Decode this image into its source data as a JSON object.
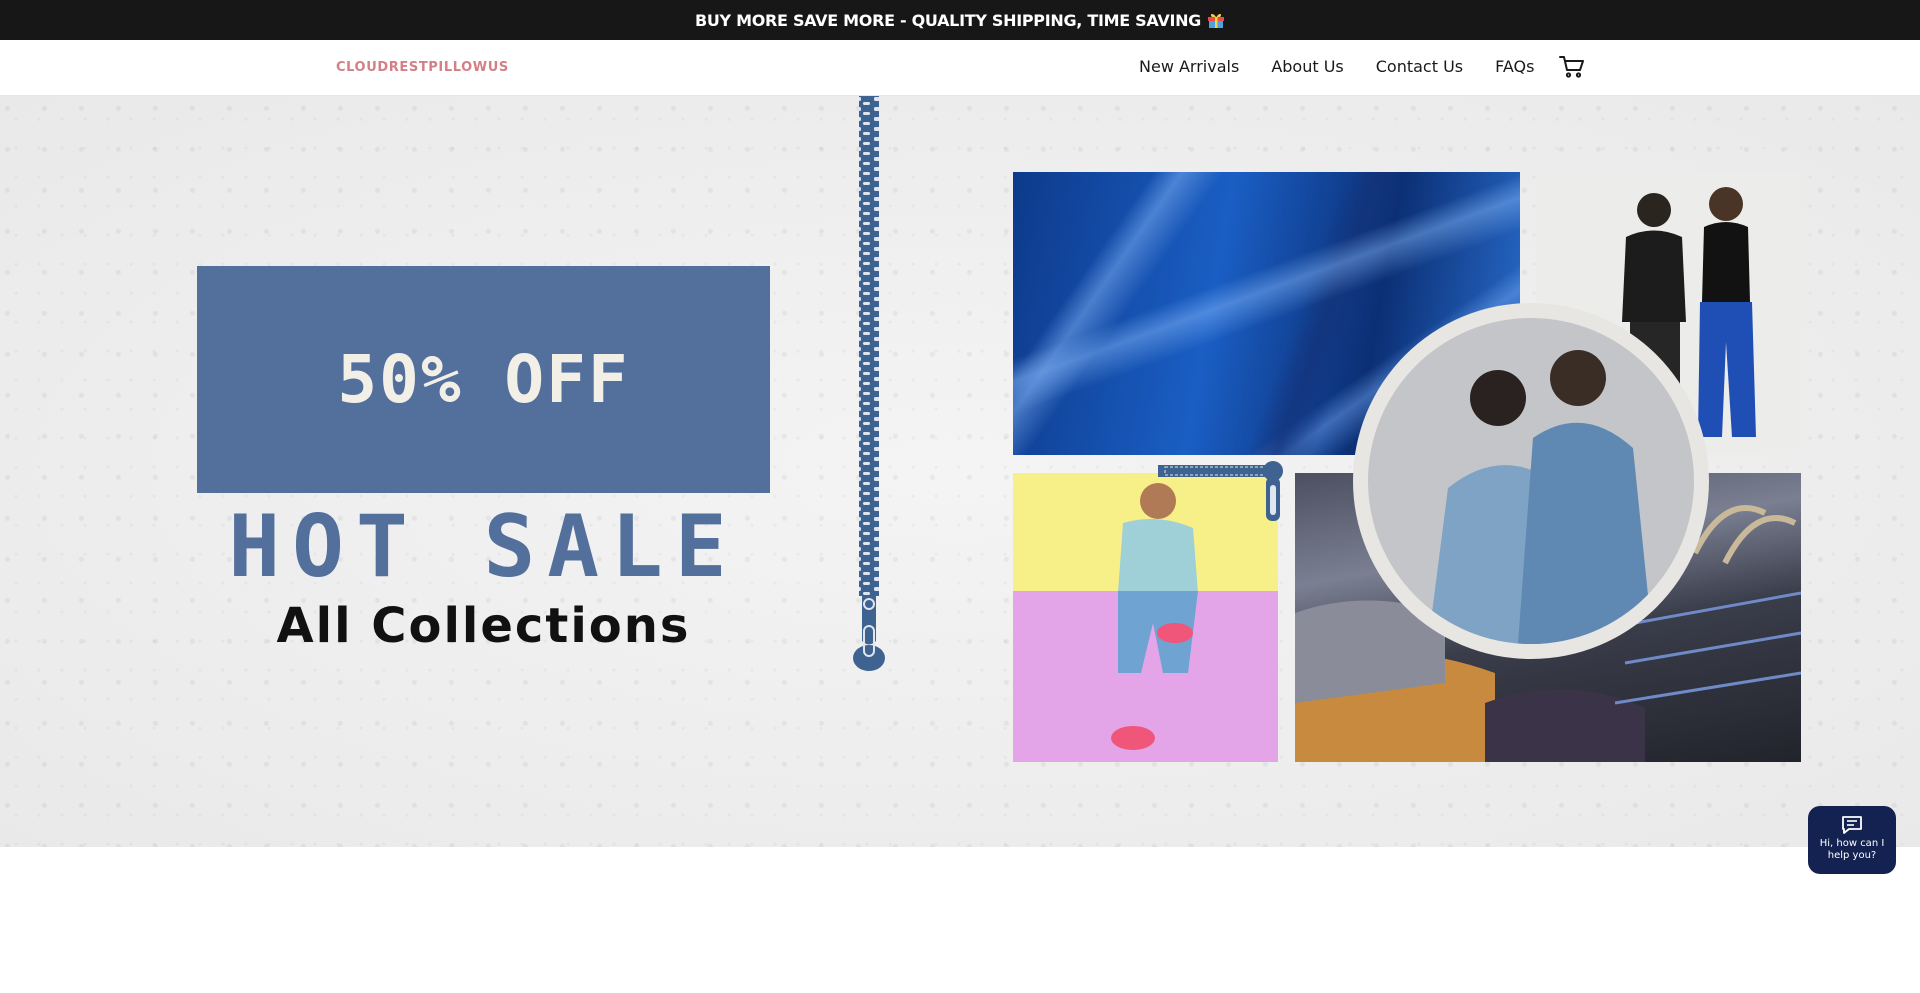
{
  "announcement": {
    "text": "BUY MORE SAVE MORE - QUALITY SHIPPING, TIME SAVING",
    "icon": "gift-icon"
  },
  "header": {
    "logo": "CLOUDRESTPILLOWUS",
    "nav": [
      {
        "label": "New Arrivals"
      },
      {
        "label": "About Us"
      },
      {
        "label": "Contact Us"
      },
      {
        "label": "FAQs"
      }
    ],
    "cart_icon": "cart-icon"
  },
  "hero": {
    "discount": "50% OFF",
    "headline": "HOT SALE",
    "subheadline": "All Collections"
  },
  "chat": {
    "text": "Hi, how can I help you?",
    "icon": "chat-icon"
  },
  "colors": {
    "announcement_bg": "#171717",
    "logo": "#d47f85",
    "brand_blue": "#536f9c",
    "chat_bg": "#142251"
  }
}
